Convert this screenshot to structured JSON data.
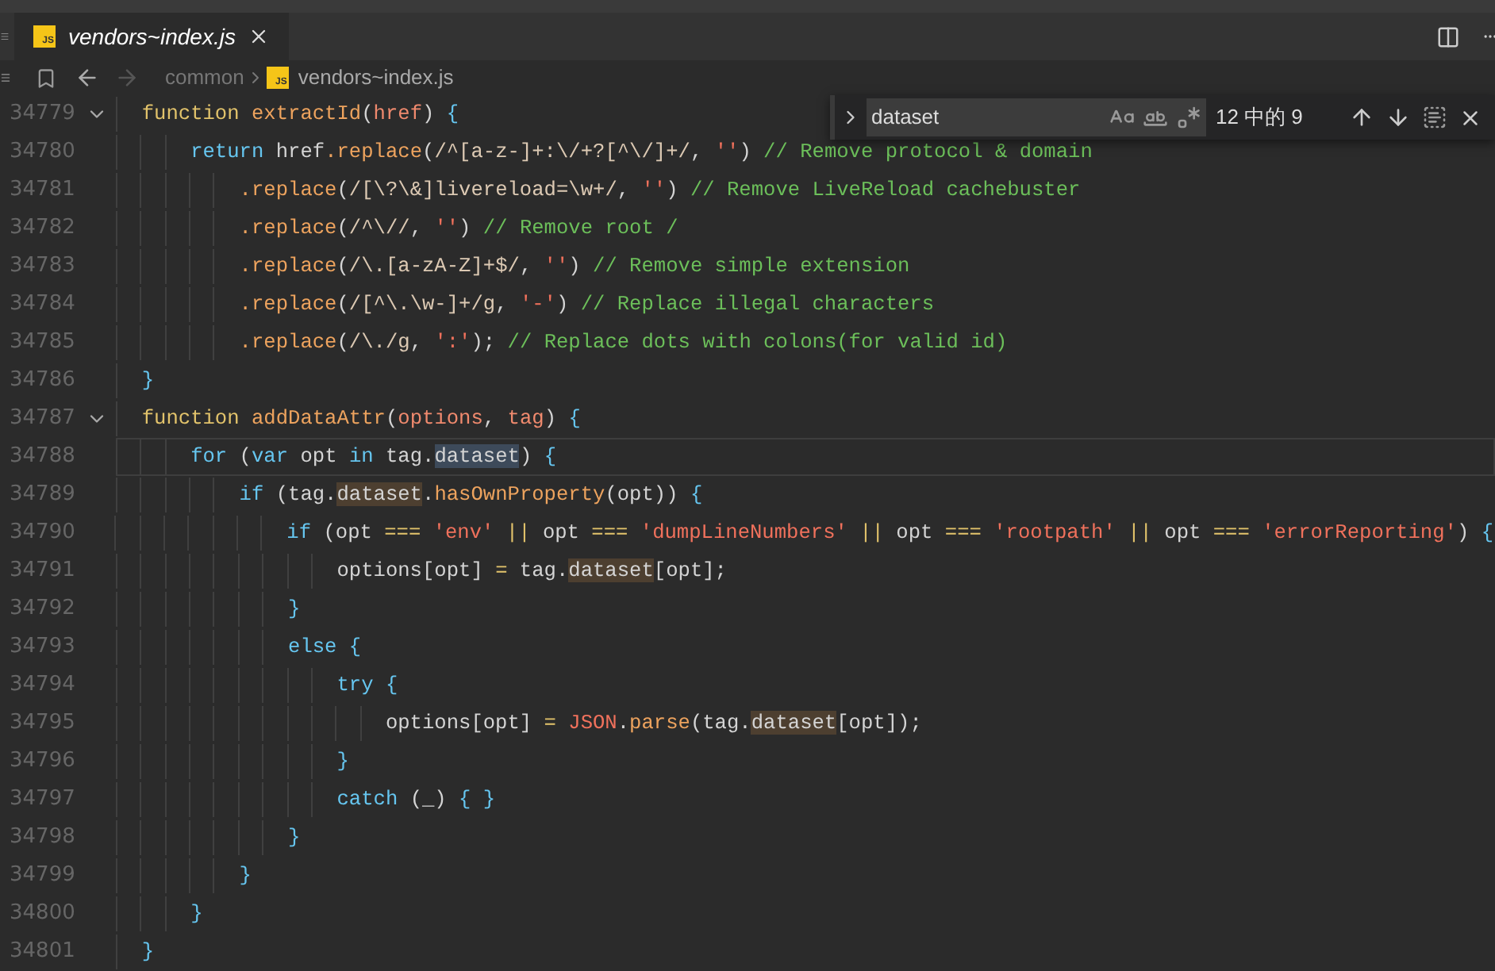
{
  "tab": {
    "icon_text": "JS",
    "label": "vendors~index.js",
    "selected": true
  },
  "breadcrumb": {
    "items": [
      {
        "label": "common",
        "kind": "folder"
      },
      {
        "label": "vendors~index.js",
        "kind": "file",
        "icon_text": "JS"
      }
    ]
  },
  "find_widget": {
    "value": "dataset",
    "result_count": "12 中的 9"
  },
  "lines": [
    {
      "number": "34779",
      "expanded": true,
      "current": false,
      "tokens": [
        {
          "text": "  function ",
          "kind": "d"
        },
        {
          "text": "extractId",
          "kind": "f"
        },
        {
          "text": "(",
          "kind": "w"
        },
        {
          "text": "href",
          "kind": "p"
        },
        {
          "text": ") ",
          "kind": "w"
        },
        {
          "text": "{",
          "kind": "b"
        }
      ]
    },
    {
      "number": "34780",
      "current": false,
      "tokens": [
        {
          "text": "      return",
          "kind": "k"
        },
        {
          "text": " href",
          "kind": "w"
        },
        {
          "text": ".replace",
          "kind": "f"
        },
        {
          "text": "(",
          "kind": "w"
        },
        {
          "text": "/^[a-z-]+:\\/+?[^\\/]+/",
          "kind": "r"
        },
        {
          "text": ", ",
          "kind": "w"
        },
        {
          "text": "''",
          "kind": "s"
        },
        {
          "text": ") ",
          "kind": "w"
        },
        {
          "text": "// Remove protocol & domain",
          "kind": "c"
        }
      ]
    },
    {
      "number": "34781",
      "current": false,
      "tokens": [
        {
          "text": "          .replace",
          "kind": "f"
        },
        {
          "text": "(",
          "kind": "w"
        },
        {
          "text": "/[\\?\\&]livereload=\\w+/",
          "kind": "r"
        },
        {
          "text": ", ",
          "kind": "w"
        },
        {
          "text": "''",
          "kind": "s"
        },
        {
          "text": ") ",
          "kind": "w"
        },
        {
          "text": "// Remove LiveReload cachebuster",
          "kind": "c"
        }
      ]
    },
    {
      "number": "34782",
      "current": false,
      "tokens": [
        {
          "text": "          .replace",
          "kind": "f"
        },
        {
          "text": "(",
          "kind": "w"
        },
        {
          "text": "/^\\//",
          "kind": "r"
        },
        {
          "text": ", ",
          "kind": "w"
        },
        {
          "text": "''",
          "kind": "s"
        },
        {
          "text": ") ",
          "kind": "w"
        },
        {
          "text": "// Remove root /",
          "kind": "c"
        }
      ]
    },
    {
      "number": "34783",
      "current": false,
      "tokens": [
        {
          "text": "          .replace",
          "kind": "f"
        },
        {
          "text": "(",
          "kind": "w"
        },
        {
          "text": "/\\.[a-zA-Z]+$/",
          "kind": "r"
        },
        {
          "text": ", ",
          "kind": "w"
        },
        {
          "text": "''",
          "kind": "s"
        },
        {
          "text": ") ",
          "kind": "w"
        },
        {
          "text": "// Remove simple extension",
          "kind": "c"
        }
      ]
    },
    {
      "number": "34784",
      "current": false,
      "tokens": [
        {
          "text": "          .replace",
          "kind": "f"
        },
        {
          "text": "(",
          "kind": "w"
        },
        {
          "text": "/[^\\.\\w-]+/g",
          "kind": "r"
        },
        {
          "text": ", ",
          "kind": "w"
        },
        {
          "text": "'-'",
          "kind": "s"
        },
        {
          "text": ") ",
          "kind": "w"
        },
        {
          "text": "// Replace illegal characters",
          "kind": "c"
        }
      ]
    },
    {
      "number": "34785",
      "current": false,
      "tokens": [
        {
          "text": "          .replace",
          "kind": "f"
        },
        {
          "text": "(",
          "kind": "w"
        },
        {
          "text": "/\\./g",
          "kind": "r"
        },
        {
          "text": ", ",
          "kind": "w"
        },
        {
          "text": "':'",
          "kind": "s"
        },
        {
          "text": "); ",
          "kind": "w"
        },
        {
          "text": "// Replace dots with colons(for valid id)",
          "kind": "c"
        }
      ]
    },
    {
      "number": "34786",
      "current": false,
      "tokens": [
        {
          "text": "  }",
          "kind": "b"
        }
      ]
    },
    {
      "number": "34787",
      "expanded": true,
      "current": false,
      "tokens": [
        {
          "text": "  function ",
          "kind": "d"
        },
        {
          "text": "addDataAttr",
          "kind": "f"
        },
        {
          "text": "(",
          "kind": "w"
        },
        {
          "text": "options",
          "kind": "p"
        },
        {
          "text": ", ",
          "kind": "w"
        },
        {
          "text": "tag",
          "kind": "p"
        },
        {
          "text": ") ",
          "kind": "w"
        },
        {
          "text": "{",
          "kind": "b"
        }
      ]
    },
    {
      "number": "34788",
      "current": true,
      "tokens": [
        {
          "text": "      for",
          "kind": "k"
        },
        {
          "text": " (",
          "kind": "w"
        },
        {
          "text": "var",
          "kind": "k"
        },
        {
          "text": " opt ",
          "kind": "w"
        },
        {
          "text": "in",
          "kind": "k"
        },
        {
          "text": " tag.",
          "kind": "w"
        },
        {
          "text": "dataset",
          "kind": "cm"
        },
        {
          "text": ") ",
          "kind": "w"
        },
        {
          "text": "{",
          "kind": "b"
        }
      ]
    },
    {
      "number": "34789",
      "current": false,
      "tokens": [
        {
          "text": "          if",
          "kind": "k"
        },
        {
          "text": " (tag.",
          "kind": "w"
        },
        {
          "text": "dataset",
          "kind": "m"
        },
        {
          "text": ".",
          "kind": "w"
        },
        {
          "text": "hasOwnProperty",
          "kind": "f"
        },
        {
          "text": "(opt)) ",
          "kind": "w"
        },
        {
          "text": "{",
          "kind": "b"
        }
      ]
    },
    {
      "number": "34790",
      "current": false,
      "tokens": [
        {
          "text": "              if",
          "kind": "k"
        },
        {
          "text": " (opt ",
          "kind": "w"
        },
        {
          "text": "=== ",
          "kind": "o"
        },
        {
          "text": "'env' ",
          "kind": "s"
        },
        {
          "text": "|| ",
          "kind": "o"
        },
        {
          "text": "opt ",
          "kind": "w"
        },
        {
          "text": "=== ",
          "kind": "o"
        },
        {
          "text": "'dumpLineNumbers' ",
          "kind": "s"
        },
        {
          "text": "|| ",
          "kind": "o"
        },
        {
          "text": "opt ",
          "kind": "w"
        },
        {
          "text": "=== ",
          "kind": "o"
        },
        {
          "text": "'rootpath' ",
          "kind": "s"
        },
        {
          "text": "|| ",
          "kind": "o"
        },
        {
          "text": "opt ",
          "kind": "w"
        },
        {
          "text": "=== ",
          "kind": "o"
        },
        {
          "text": "'errorReporting'",
          "kind": "s"
        },
        {
          "text": ") ",
          "kind": "w"
        },
        {
          "text": "{",
          "kind": "b"
        }
      ]
    },
    {
      "number": "34791",
      "current": false,
      "tokens": [
        {
          "text": "                  options[opt] ",
          "kind": "w"
        },
        {
          "text": "= ",
          "kind": "o"
        },
        {
          "text": "tag.",
          "kind": "w"
        },
        {
          "text": "dataset",
          "kind": "m"
        },
        {
          "text": "[opt];",
          "kind": "w"
        }
      ]
    },
    {
      "number": "34792",
      "current": false,
      "tokens": [
        {
          "text": "              }",
          "kind": "b"
        }
      ]
    },
    {
      "number": "34793",
      "current": false,
      "tokens": [
        {
          "text": "              else ",
          "kind": "k"
        },
        {
          "text": "{",
          "kind": "b"
        }
      ]
    },
    {
      "number": "34794",
      "current": false,
      "tokens": [
        {
          "text": "                  try ",
          "kind": "k"
        },
        {
          "text": "{",
          "kind": "b"
        }
      ]
    },
    {
      "number": "34795",
      "current": false,
      "tokens": [
        {
          "text": "                      options[opt] ",
          "kind": "w"
        },
        {
          "text": "= ",
          "kind": "o"
        },
        {
          "text": "JSON",
          "kind": "s"
        },
        {
          "text": ".",
          "kind": "w"
        },
        {
          "text": "parse",
          "kind": "f"
        },
        {
          "text": "(tag.",
          "kind": "w"
        },
        {
          "text": "dataset",
          "kind": "m"
        },
        {
          "text": "[opt]);",
          "kind": "w"
        }
      ]
    },
    {
      "number": "34796",
      "current": false,
      "tokens": [
        {
          "text": "                  }",
          "kind": "b"
        }
      ]
    },
    {
      "number": "34797",
      "current": false,
      "tokens": [
        {
          "text": "                  catch",
          "kind": "k"
        },
        {
          "text": " (_) ",
          "kind": "w"
        },
        {
          "text": "{ }",
          "kind": "b"
        }
      ]
    },
    {
      "number": "34798",
      "current": false,
      "tokens": [
        {
          "text": "              }",
          "kind": "b"
        }
      ]
    },
    {
      "number": "34799",
      "current": false,
      "tokens": [
        {
          "text": "          }",
          "kind": "b"
        }
      ]
    },
    {
      "number": "34800",
      "current": false,
      "tokens": [
        {
          "text": "      }",
          "kind": "b"
        }
      ]
    },
    {
      "number": "34801",
      "current": false,
      "tokens": [
        {
          "text": "  }",
          "kind": "b"
        }
      ]
    }
  ]
}
